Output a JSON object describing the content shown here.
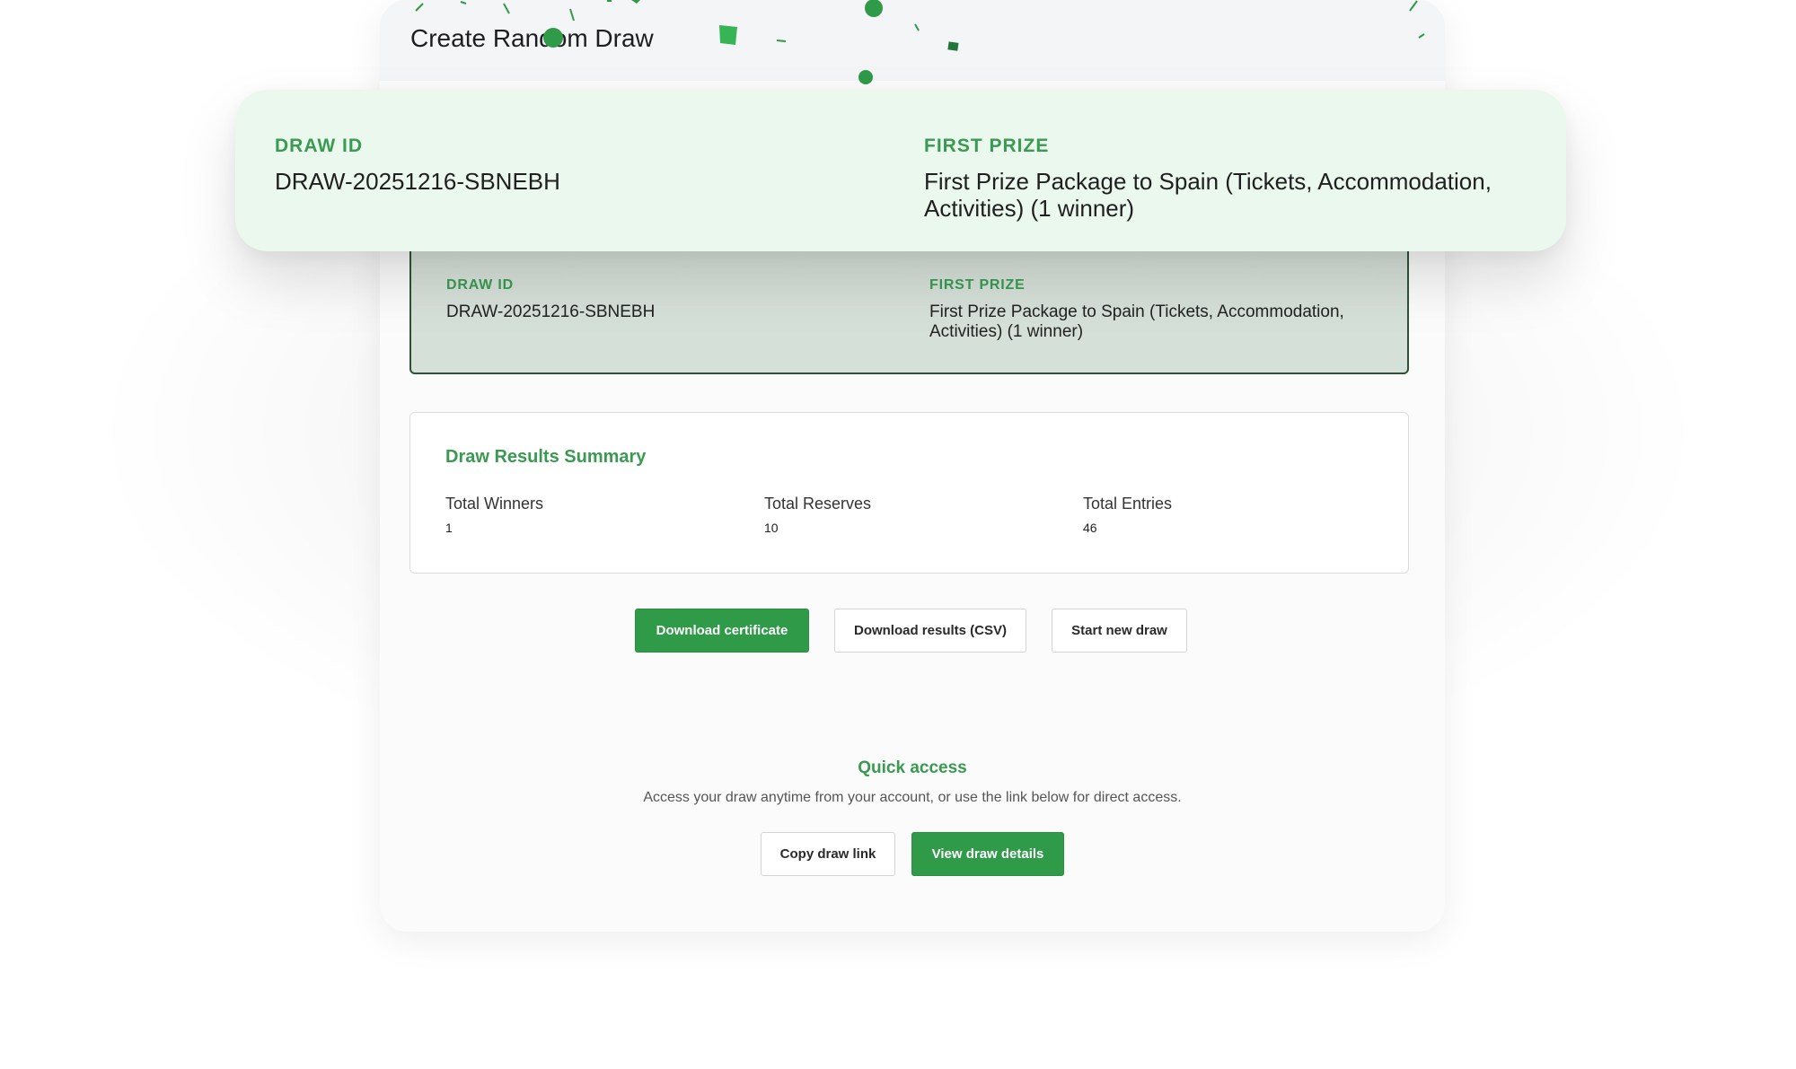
{
  "header": {
    "title": "Create Random Draw"
  },
  "draw_info": {
    "draw_id_label": "DRAW ID",
    "draw_id": "DRAW-20251216-SBNEBH",
    "first_prize_label": "FIRST PRIZE",
    "first_prize": "First Prize Package to Spain (Tickets, Accommodation, Activities) (1 winner)"
  },
  "summary": {
    "title": "Draw Results Summary",
    "stats": [
      {
        "label": "Total Winners",
        "value": "1"
      },
      {
        "label": "Total Reserves",
        "value": "10"
      },
      {
        "label": "Total Entries",
        "value": "46"
      }
    ]
  },
  "actions": {
    "download_certificate": "Download certificate",
    "download_csv": "Download results (CSV)",
    "start_new_draw": "Start new draw"
  },
  "quick_access": {
    "title": "Quick access",
    "description": "Access your draw anytime from your account, or use the link below for direct access.",
    "copy_link": "Copy draw link",
    "view_details": "View draw details"
  },
  "colors": {
    "accent_green": "#2f9a48",
    "label_green": "#3a9a52",
    "overlay_background": "#eaf8ee",
    "info_box_background": "#d5e0d8",
    "info_box_border": "#2f5237"
  },
  "icons": [
    "confetti-decoration"
  ]
}
